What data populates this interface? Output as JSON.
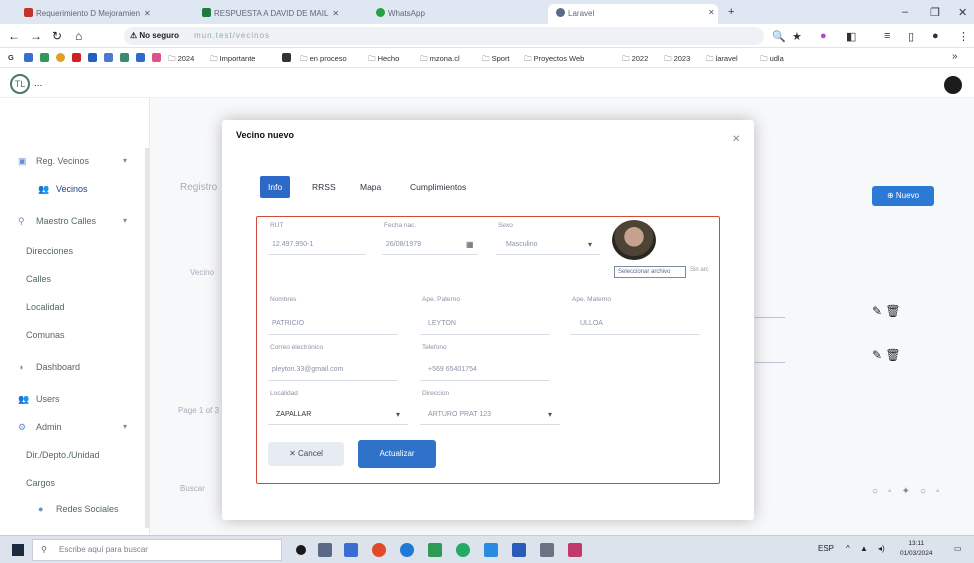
{
  "browser": {
    "tabs": [
      {
        "title": "Requerimiento D Mejoramien",
        "active": false,
        "icon": "gmail-icon",
        "color": "#c5322b"
      },
      {
        "title": "RESPUESTA A DAVID DE MAIL",
        "active": false,
        "icon": "sheets-icon",
        "color": "#1f7a3f"
      },
      {
        "title": "WhatsApp",
        "active": false,
        "icon": "whatsapp-icon",
        "color": "#25a244"
      },
      {
        "title": "Laravel",
        "active": true,
        "icon": "globe-icon",
        "color": "#5a6a86"
      }
    ],
    "address": {
      "secure_label": "No seguro",
      "url": "mun.test/vecinos"
    },
    "bookmarks": [
      "2024",
      "Importante",
      "en proceso",
      "Hecho",
      "mzona.cl",
      "Sport",
      "Proyectos Web",
      "2022",
      "2023",
      "laravel",
      "udla"
    ]
  },
  "app": {
    "logo_text": "TL",
    "logo_dots": "..."
  },
  "sidebar": {
    "items": [
      {
        "label": "Reg. Vecinos",
        "icon": "user-card-icon",
        "type": "group"
      },
      {
        "label": "Vecinos",
        "icon": "users-icon",
        "type": "sub",
        "active": true
      },
      {
        "label": "Maestro Calles",
        "icon": "map-icon",
        "type": "group"
      },
      {
        "label": "Direcciones",
        "type": "plain"
      },
      {
        "label": "Calles",
        "type": "plain"
      },
      {
        "label": "Localidad",
        "type": "plain"
      },
      {
        "label": "Comunas",
        "type": "plain"
      },
      {
        "label": "Dashboard",
        "icon": "dashboard-icon",
        "type": "top"
      },
      {
        "label": "Users",
        "icon": "users-icon",
        "type": "top"
      },
      {
        "label": "Admin",
        "icon": "gear-icon",
        "type": "group"
      },
      {
        "label": "Dir./Depto./Unidad",
        "type": "plain"
      },
      {
        "label": "Cargos",
        "type": "plain"
      },
      {
        "label": "Redes Sociales",
        "icon": "share-icon",
        "type": "sub"
      }
    ]
  },
  "background": {
    "heading": "Registro",
    "new_button": "Nuevo",
    "pagination": "Page 1 of 3",
    "search_hint": "Buscar",
    "col_vecino": "Vecino"
  },
  "modal": {
    "title": "Vecino nuevo",
    "tabs": [
      "Info",
      "RRSS",
      "Mapa",
      "Cumplimientos"
    ],
    "fields": {
      "rut": {
        "label": "RUT",
        "value": "12.497.950-1"
      },
      "fecha_nac": {
        "label": "Fecha nac.",
        "value": "26/08/1979"
      },
      "sexo": {
        "label": "Sexo",
        "value": "Masculino"
      },
      "nombres": {
        "label": "Nombres",
        "value": "PATRICIO"
      },
      "ape_paterno": {
        "label": "Ape. Paterno",
        "value": "LEYTON"
      },
      "ape_materno": {
        "label": "Ape. Materno",
        "value": "ULLOA"
      },
      "correo": {
        "label": "Correo electrónico",
        "value": "pleyton.33@gmail.com"
      },
      "telefono": {
        "label": "Telefono",
        "value": "+569 65401754"
      },
      "localidad": {
        "label": "Localidad",
        "value": "ZAPALLAR"
      },
      "direccion": {
        "label": "Direccion",
        "value": "ARTURO PRAT 123"
      }
    },
    "photo_button": "Seleccionar archivo",
    "photo_status": "Sin arc",
    "cancel_label": "Cancel",
    "save_label": "Actualizar"
  },
  "taskbar": {
    "search_placeholder": "Escribe aquí para buscar",
    "time": "13:11",
    "date": "01/03/2024",
    "language": "ESP"
  }
}
